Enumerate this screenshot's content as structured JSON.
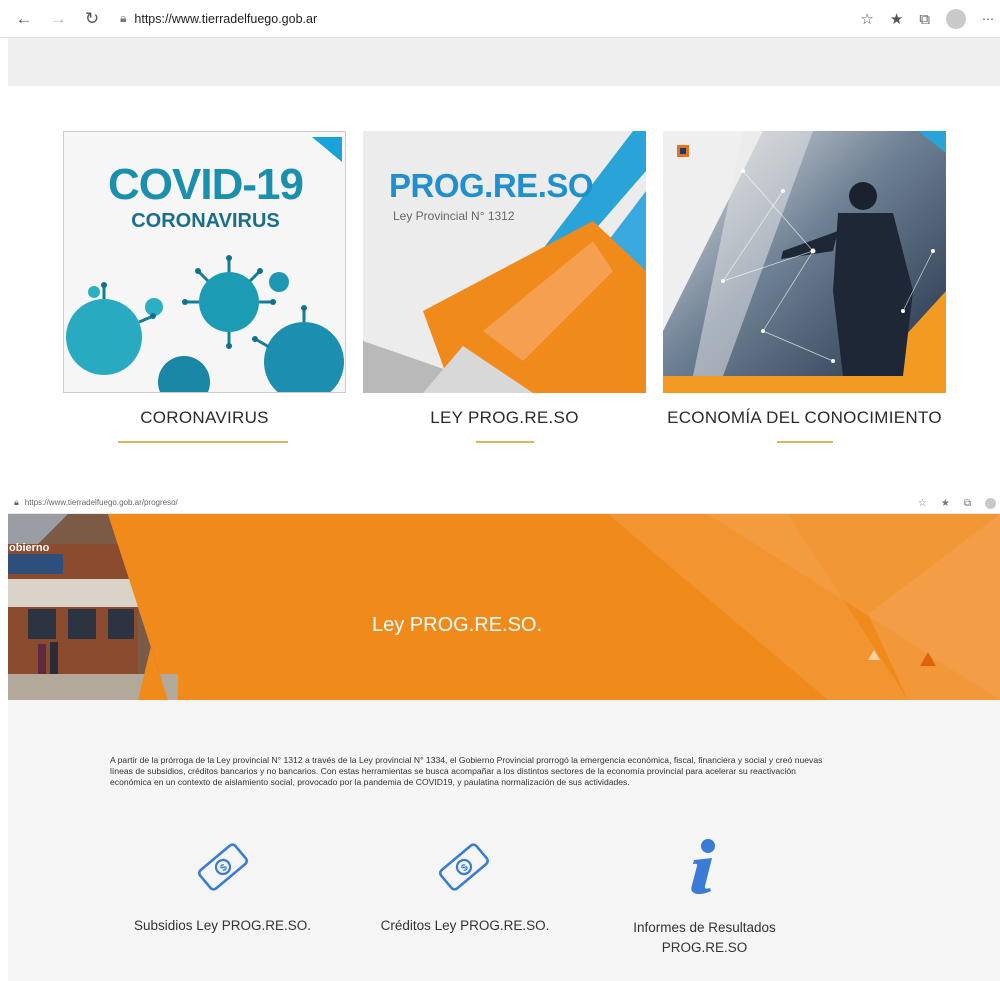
{
  "browser_top": {
    "url": "https://www.tierradelfuego.gob.ar",
    "back_icon": "arrow-left-icon",
    "forward_icon": "arrow-right-icon",
    "refresh_icon": "refresh-icon",
    "lock_icon": "lock-icon"
  },
  "cards": [
    {
      "caption": "CORONAVIRUS",
      "art_title": "COVID-19",
      "art_subtitle": "CORONAVIRUS"
    },
    {
      "caption": "LEY PROG.RE.SO",
      "art_title": "PROG.RE.SO",
      "art_subtitle": "Ley Provincial N° 1312"
    },
    {
      "caption": "ECONOMÍA DEL CONOCIMIENTO"
    }
  ],
  "browser_bottom": {
    "url": "https://www.tierradelfuego.gob.ar/progreso/"
  },
  "hero": {
    "title": "Ley PROG.RE.SO.",
    "building_sign": "obierno"
  },
  "intro_text": "A partir de la prórroga de la Ley provincial N° 1312 a través de la Ley provincial N° 1334, el Gobierno Provincial prorrogó la emergencia económica, fiscal, financiera y social y creó nuevas líneas de subsidios, créditos bancarios y no bancarios. Con estas herramientas se busca acompañar a los distintos sectores de la economía provincial para acelerar su reactivación económica en un contexto de aislamiento social, provocado por la pandemia de COVID19, y paulatina normalización de sus actividades.",
  "services": [
    {
      "label": "Subsidios Ley PROG.RE.SO.",
      "icon": "money-bill-icon"
    },
    {
      "label": "Créditos Ley PROG.RE.SO.",
      "icon": "money-bill-icon"
    },
    {
      "label": "Informes de Resultados PROG.RE.SO",
      "icon": "info-icon"
    }
  ],
  "colors": {
    "accent_orange": "#f08a1a",
    "underline_gold": "#d8b45a",
    "icon_blue": "#3a7bd5",
    "covid_teal": "#1b9bb8"
  }
}
